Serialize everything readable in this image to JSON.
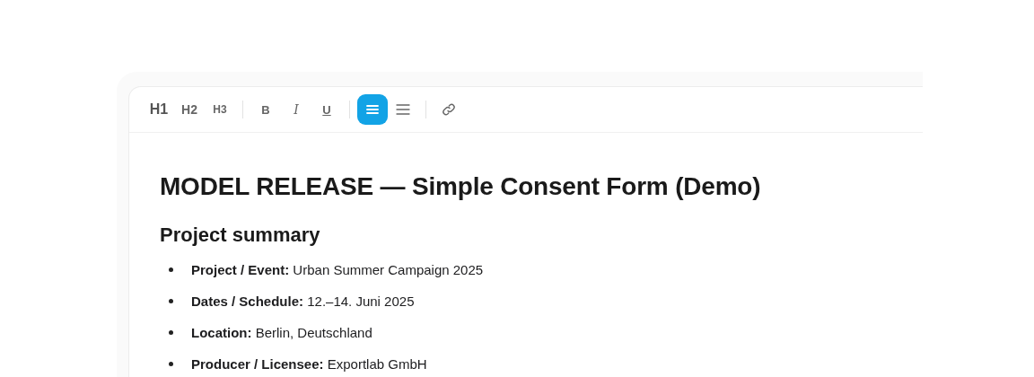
{
  "toolbar": {
    "groups": [
      [
        {
          "kind": "h1",
          "label": "H1",
          "selected": false
        },
        {
          "kind": "h2",
          "label": "H2",
          "selected": false
        },
        {
          "kind": "h3",
          "label": "H3",
          "selected": false
        }
      ],
      [
        {
          "kind": "bold",
          "label": "B",
          "selected": false
        },
        {
          "kind": "italic",
          "label": "I",
          "selected": false
        },
        {
          "kind": "underline",
          "label": "U",
          "selected": false
        }
      ],
      [
        {
          "kind": "align",
          "selected": true
        },
        {
          "kind": "lines",
          "selected": false
        }
      ],
      [
        {
          "kind": "link",
          "selected": false
        }
      ]
    ]
  },
  "document": {
    "title": "MODEL RELEASE — Simple Consent Form (Demo)",
    "heading": "Project summary",
    "items": [
      "**Project / Event:** Urban Summer Campaign 2025",
      "**Dates / Schedule:** 12.–14. Juni 2025",
      "**Location:** Berlin, Deutschland",
      "**Producer / Licensee:** Exportlab GmbH"
    ]
  }
}
